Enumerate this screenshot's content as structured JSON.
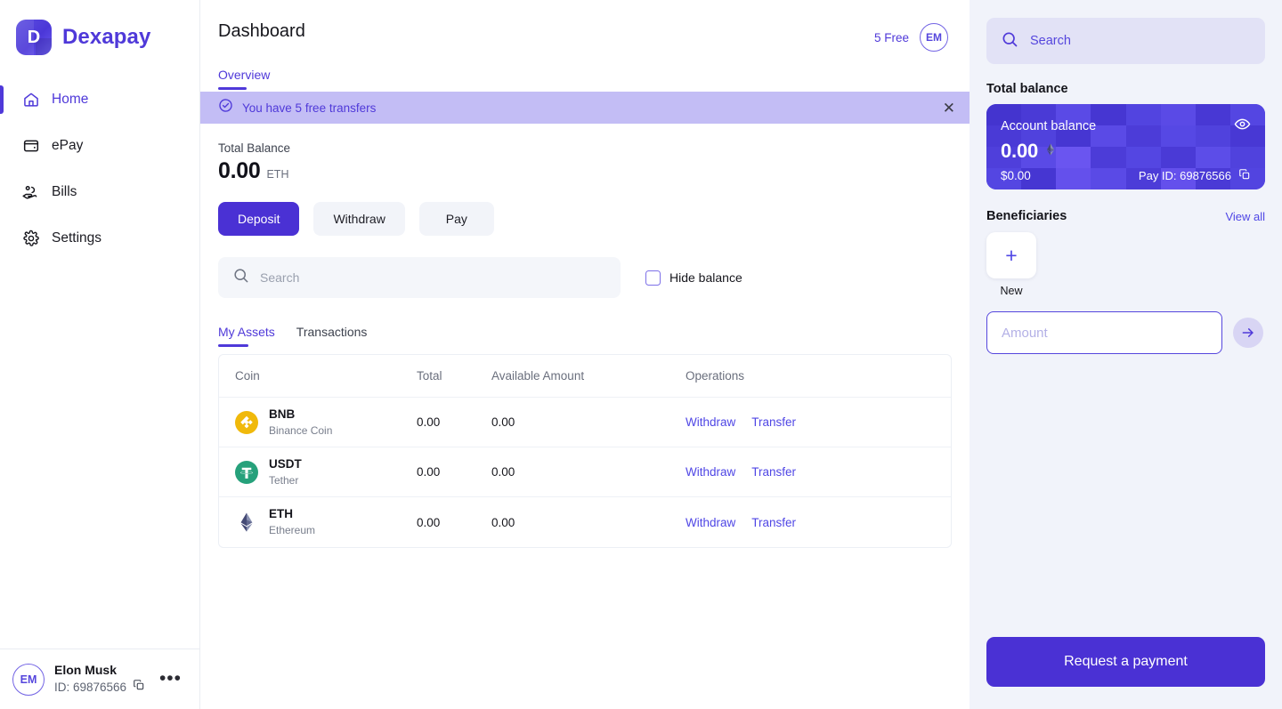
{
  "brand": {
    "initial": "D",
    "name": "Dexapay"
  },
  "sidebar": {
    "items": [
      {
        "label": "Home",
        "icon": "home-icon"
      },
      {
        "label": "ePay",
        "icon": "wallet-icon"
      },
      {
        "label": "Bills",
        "icon": "bills-hand-icon"
      },
      {
        "label": "Settings",
        "icon": "gear-icon"
      }
    ],
    "user": {
      "initials": "EM",
      "name": "Elon Musk",
      "id_label": "ID: 69876566",
      "copy_icon": "copy-icon",
      "more_icon": "ellipsis-icon"
    }
  },
  "header": {
    "title": "Dashboard",
    "free_label": "5 Free",
    "avatar_initials": "EM",
    "tabs": [
      {
        "label": "Overview",
        "active": true
      }
    ]
  },
  "banner": {
    "icon": "check-circle-icon",
    "text": "You have 5 free transfers",
    "close_icon": "close-icon"
  },
  "balance": {
    "label": "Total Balance",
    "amount": "0.00",
    "unit": "ETH"
  },
  "actions": {
    "deposit": "Deposit",
    "withdraw": "Withdraw",
    "pay": "Pay"
  },
  "search": {
    "placeholder": "Search",
    "value": "",
    "icon": "search-icon"
  },
  "hide_balance": {
    "label": "Hide balance",
    "checked": false
  },
  "asset_tabs": [
    {
      "label": "My Assets",
      "active": true
    },
    {
      "label": "Transactions",
      "active": false
    }
  ],
  "assets_table": {
    "columns": [
      "Coin",
      "Total",
      "Available Amount",
      "Operations"
    ],
    "rows": [
      {
        "symbol": "BNB",
        "name": "Binance Coin",
        "icon": "bnb-icon",
        "total": "0.00",
        "available": "0.00",
        "ops": [
          "Withdraw",
          "Transfer"
        ]
      },
      {
        "symbol": "USDT",
        "name": "Tether",
        "icon": "usdt-icon",
        "total": "0.00",
        "available": "0.00",
        "ops": [
          "Withdraw",
          "Transfer"
        ]
      },
      {
        "symbol": "ETH",
        "name": "Ethereum",
        "icon": "eth-icon",
        "total": "0.00",
        "available": "0.00",
        "ops": [
          "Withdraw",
          "Transfer"
        ]
      }
    ]
  },
  "right": {
    "search": {
      "placeholder": "Search",
      "value": "",
      "icon": "search-icon"
    },
    "total_balance_heading": "Total balance",
    "card": {
      "label": "Account balance",
      "eye_icon": "eye-icon",
      "amount": "0.00",
      "currency_icon": "eth-icon",
      "usd": "$0.00",
      "pay_id": "Pay ID: 69876566",
      "copy_icon": "copy-icon"
    },
    "beneficiaries": {
      "title": "Beneficiaries",
      "view_all": "View all",
      "new_label": "New",
      "plus_icon": "plus-icon"
    },
    "amount_input": {
      "placeholder": "Amount",
      "value": "",
      "submit_icon": "arrow-right-icon"
    },
    "request_button": "Request a payment"
  },
  "colors": {
    "accent": "#4f39d9",
    "accent_button": "#4a31d4",
    "banner_bg": "#c3bdf5",
    "panel_bg": "#f1f3fa",
    "link": "#4f46e5"
  }
}
